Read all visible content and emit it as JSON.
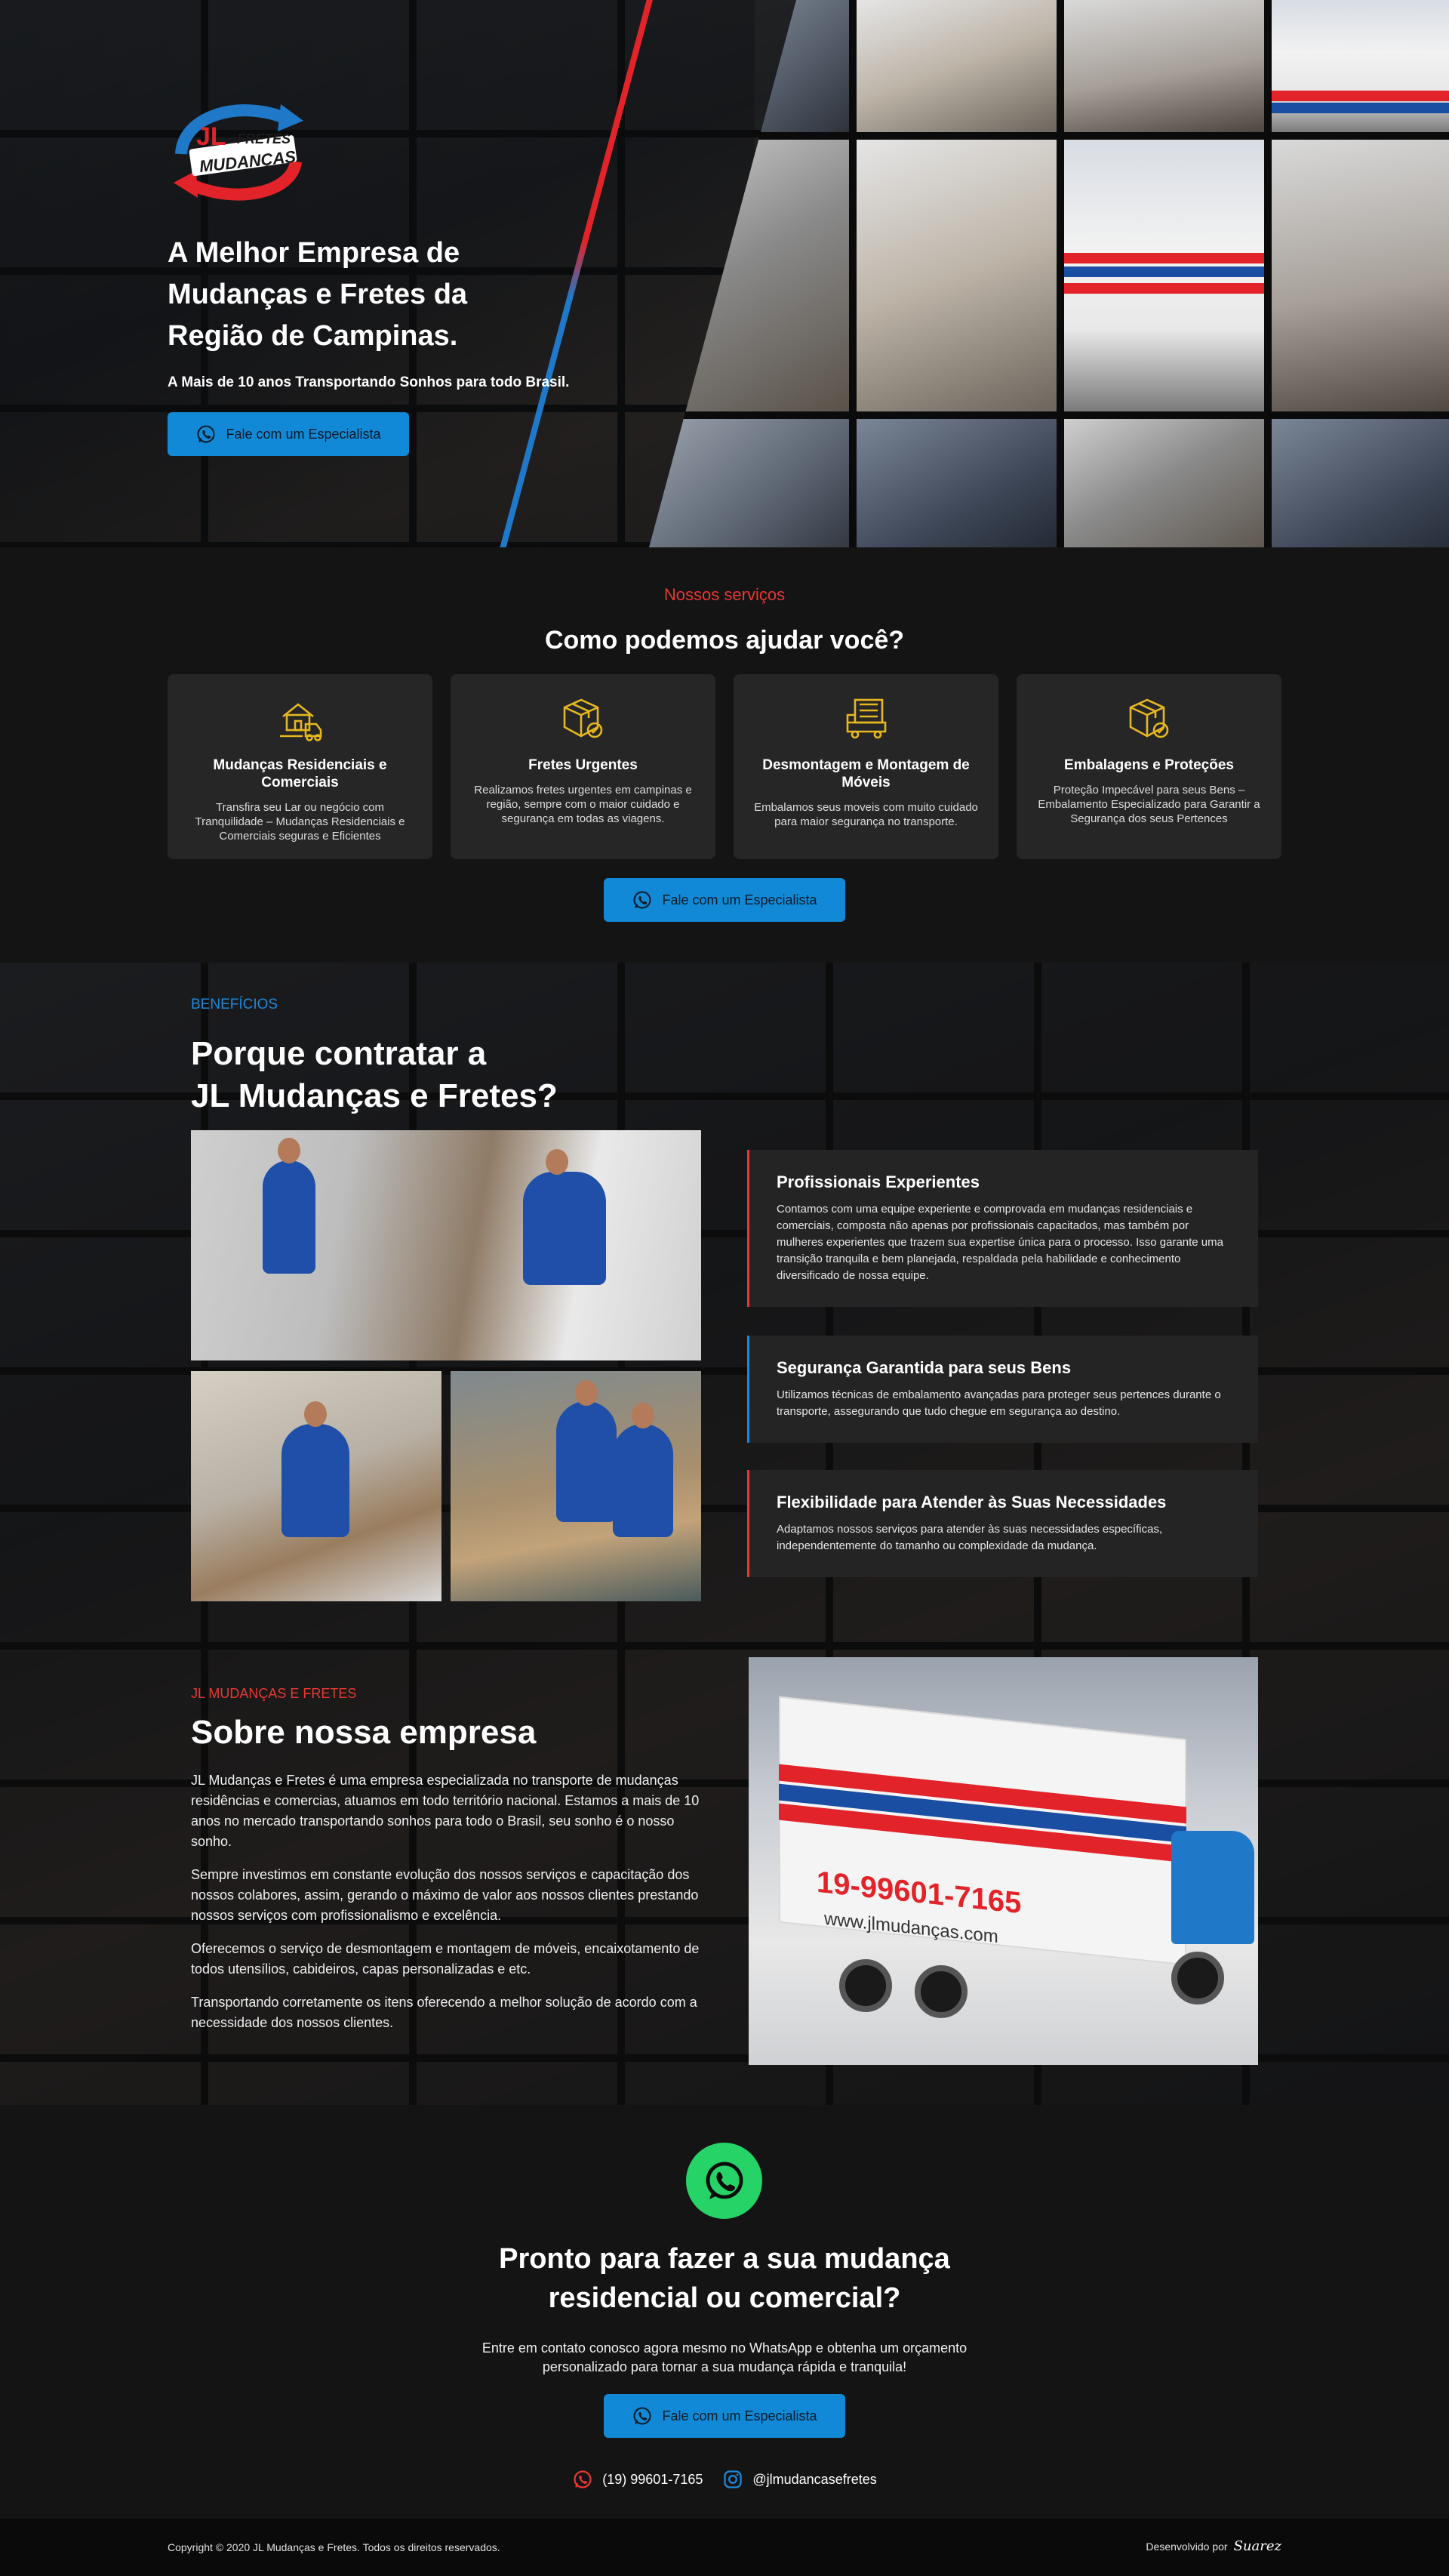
{
  "hero": {
    "logo_text_main": "JL",
    "logo_text_fretes": "FRETES",
    "logo_text_mudancas": "MUDANÇAS",
    "title": "A Melhor Empresa de Mudanças e Fretes da Região de Campinas.",
    "subtitle": "A Mais de 10 anos Transportando Sonhos para todo Brasil.",
    "cta_label": "Fale com um Especialista"
  },
  "services": {
    "eyebrow": "Nossos serviços",
    "title": "Como podemos ajudar você?",
    "cards": [
      {
        "icon": "house-truck-icon",
        "title": "Mudanças Residenciais e Comerciais",
        "text": "Transfira seu Lar ou negócio com Tranquilidade – Mudanças Residenciais e Comerciais seguras e Eficientes"
      },
      {
        "icon": "box-check-icon",
        "title": "Fretes Urgentes",
        "text": "Realizamos fretes urgentes em campinas e região, sempre com o maior cuidado e segurança em todas as viagens."
      },
      {
        "icon": "furniture-truck-icon",
        "title": "Desmontagem e Montagem de Móveis",
        "text": "Embalamos seus moveis com muito cuidado para maior segurança no transporte."
      },
      {
        "icon": "package-shield-icon",
        "title": "Embalagens e Proteções",
        "text": "Proteção Impecável para seus Bens – Embalamento Especializado para Garantir a Segurança dos seus Pertences"
      }
    ],
    "cta_label": "Fale com um Especialista"
  },
  "benefits": {
    "eyebrow": "BENEFÍCIOS",
    "title_line1": "Porque contratar a",
    "title_line2": "JL Mudanças e Fretes?",
    "items": [
      {
        "title": "Profissionais Experientes",
        "text": "Contamos com uma equipe experiente e comprovada em mudanças residenciais e comerciais, composta não apenas por profissionais capacitados, mas também por mulheres experientes que trazem sua expertise única para o processo. Isso garante uma transição tranquila e bem planejada, respaldada pela habilidade e conhecimento diversificado de nossa equipe."
      },
      {
        "title": "Segurança Garantida para seus Bens",
        "text": "Utilizamos técnicas de embalamento avançadas para proteger seus pertences durante o transporte, assegurando que tudo chegue em segurança ao destino."
      },
      {
        "title": "Flexibilidade para Atender às Suas Necessidades",
        "text": "Adaptamos nossos serviços para atender às suas necessidades específicas, independentemente do tamanho ou complexidade da mudança."
      }
    ]
  },
  "about": {
    "eyebrow": "JL MUDANÇAS E FRETES",
    "title": "Sobre nossa empresa",
    "paragraphs": [
      "JL Mudanças e Fretes é uma empresa especializada no transporte de mudanças residências e comercias, atuamos em todo território nacional. Estamos a mais de 10 anos no mercado transportando sonhos para todo o Brasil, seu sonho é o nosso sonho.",
      "Sempre investimos em constante evolução dos nossos serviços e capacitação dos nossos colabores, assim, gerando o máximo de valor aos nossos clientes prestando nossos serviços com profissionalismo e excelência.",
      "Oferecemos o serviço de desmontagem e montagem de móveis, encaixotamento de todos utensílios, cabideiros, capas personalizadas e etc.",
      "Transportando corretamente os itens oferecendo a melhor solução de acordo com a necessidade dos nossos clientes."
    ],
    "truck_phone": "19-99601-7165",
    "truck_site": "www.jlmudanças.com"
  },
  "cta": {
    "title_line1": "Pronto para fazer a sua mudança",
    "title_line2": "residencial ou comercial?",
    "text": "Entre em contato conosco agora mesmo no WhatsApp e obtenha um orçamento personalizado para tornar a sua mudança rápida e tranquila!",
    "button_label": "Fale com um Especialista",
    "phone": "(19) 99601-7165",
    "instagram": "@jlmudancasefretes"
  },
  "footer": {
    "copyright": "Copyright © 2020 JL Mudanças e Fretes. Todos os direitos reservados.",
    "dev_label": "Desenvolvido por",
    "dev_signature": "Suarez"
  },
  "colors": {
    "accent_blue": "#1189d6",
    "accent_red": "#e53935",
    "whatsapp_green": "#25d366",
    "icon_yellow": "#e6b820"
  }
}
